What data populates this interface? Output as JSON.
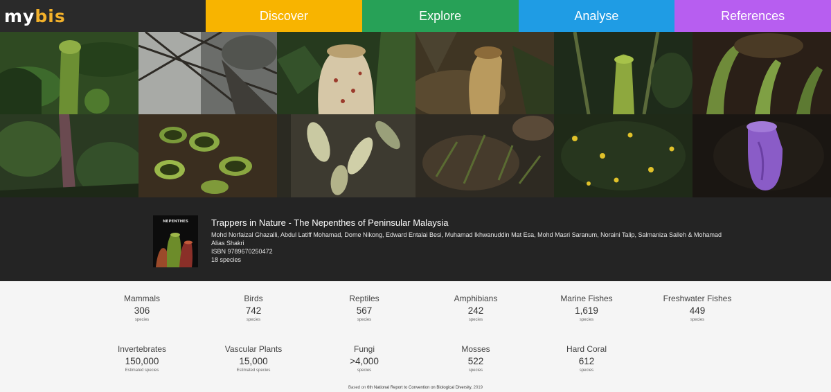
{
  "brand": {
    "part1": "my",
    "part2": "bis"
  },
  "nav": [
    {
      "label": "Discover",
      "color": "#f8b400"
    },
    {
      "label": "Explore",
      "color": "#27a157"
    },
    {
      "label": "Analyse",
      "color": "#1f9ce4"
    },
    {
      "label": "References",
      "color": "#b75ef0"
    }
  ],
  "featured": {
    "title": "Trappers in Nature - The Nepenthes of Peninsular Malaysia",
    "authors": "Mohd Norfaizal Ghazalli, Abdul Latiff Mohamad, Dome Nikong, Edward Entalai Besi, Muhamad Ikhwanuddin Mat Esa, Mohd Masri Saranum, Noraini Talip, Salmaniza Salleh & Mohamad Alias Shakri",
    "isbn": "ISBN 9789670250472",
    "species": "18 species",
    "cover_text": "NEPENTHES"
  },
  "stats": [
    {
      "name": "Mammals",
      "value": "306",
      "unit": "species"
    },
    {
      "name": "Birds",
      "value": "742",
      "unit": "species"
    },
    {
      "name": "Reptiles",
      "value": "567",
      "unit": "species"
    },
    {
      "name": "Amphibians",
      "value": "242",
      "unit": "species"
    },
    {
      "name": "Marine Fishes",
      "value": "1,619",
      "unit": "species"
    },
    {
      "name": "Freshwater Fishes",
      "value": "449",
      "unit": "species"
    },
    {
      "name": "Invertebrates",
      "value": "150,000",
      "unit": "Estimated species"
    },
    {
      "name": "Vascular Plants",
      "value": "15,000",
      "unit": "Estimated species"
    },
    {
      "name": "Fungi",
      "value": ">4,000",
      "unit": "species"
    },
    {
      "name": "Mosses",
      "value": "522",
      "unit": "species"
    },
    {
      "name": "Hard Coral",
      "value": "612",
      "unit": "species"
    }
  ],
  "source": {
    "prefix": "Based on",
    "link": "6th National Report to Convention on Biological Diversity",
    "suffix": ", 2019"
  }
}
